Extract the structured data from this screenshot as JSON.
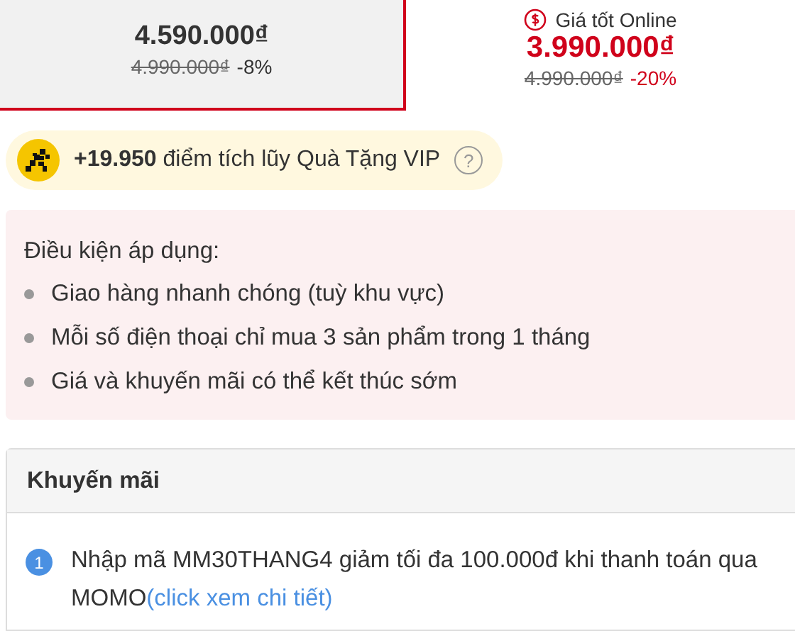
{
  "price_options": [
    {
      "kind": "selected_card",
      "selected": true,
      "price": "4.590.000₫",
      "old_price": "4.990.000₫",
      "discount": "-8%"
    },
    {
      "kind": "online",
      "selected": false,
      "label": "Giá tốt Online",
      "price": "3.990.000₫",
      "old_price": "4.990.000₫",
      "discount": "-20%"
    }
  ],
  "vip_points": {
    "amount": "+19.950",
    "text": "điểm tích lũy Quà Tặng VIP",
    "help": "?"
  },
  "conditions": {
    "title": "Điều kiện áp dụng:",
    "items": [
      "Giao hàng nhanh chóng (tuỳ khu vực)",
      "Mỗi số điện thoại chỉ mua 3 sản phẩm trong 1 tháng",
      "Giá và khuyến mãi có thể kết thúc sớm"
    ]
  },
  "promotions": {
    "title": "Khuyến mãi",
    "items": [
      {
        "number": "1",
        "text": "Nhập mã MM30THANG4 giảm tối đa 100.000đ khi thanh toán qua MOMO",
        "link": "(click xem chi tiết)"
      }
    ]
  }
}
